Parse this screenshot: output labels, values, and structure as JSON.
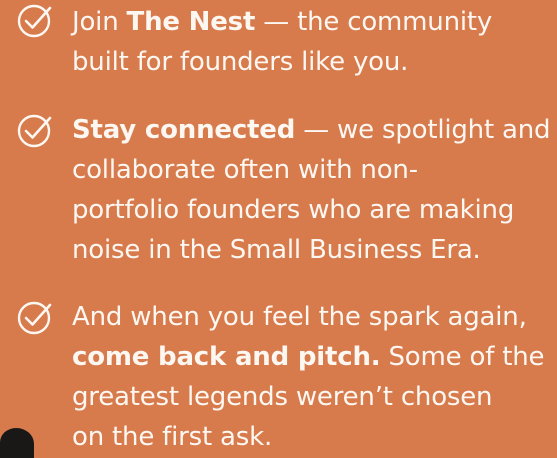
{
  "items": [
    {
      "icon": "check-circle-icon",
      "lines": [
        {
          "pre": "Join ",
          "bold": "The Nest",
          "post": " — the community"
        },
        {
          "pre": "built for founders like you.",
          "bold": "",
          "post": ""
        }
      ]
    },
    {
      "icon": "check-circle-icon",
      "lines": [
        {
          "pre": "",
          "bold": "Stay connected",
          "post": " — we spotlight and"
        },
        {
          "pre": "collaborate often with non-",
          "bold": "",
          "post": ""
        },
        {
          "pre": "portfolio founders who are making",
          "bold": "",
          "post": ""
        },
        {
          "pre": "noise in the Small Business Era.",
          "bold": "",
          "post": ""
        }
      ]
    },
    {
      "icon": "check-circle-icon",
      "lines": [
        {
          "pre": "And when you feel the spark again,",
          "bold": "",
          "post": ""
        },
        {
          "pre": "",
          "bold": "come back and pitch.",
          "post": " Some of the"
        },
        {
          "pre": "greatest legends weren’t chosen",
          "bold": "",
          "post": ""
        },
        {
          "pre": "on the first ask.",
          "bold": "",
          "post": ""
        }
      ]
    }
  ],
  "colors": {
    "background": "#D77B4D",
    "text": "#FDF7F2",
    "icon_stroke": "#FDF7F2"
  }
}
